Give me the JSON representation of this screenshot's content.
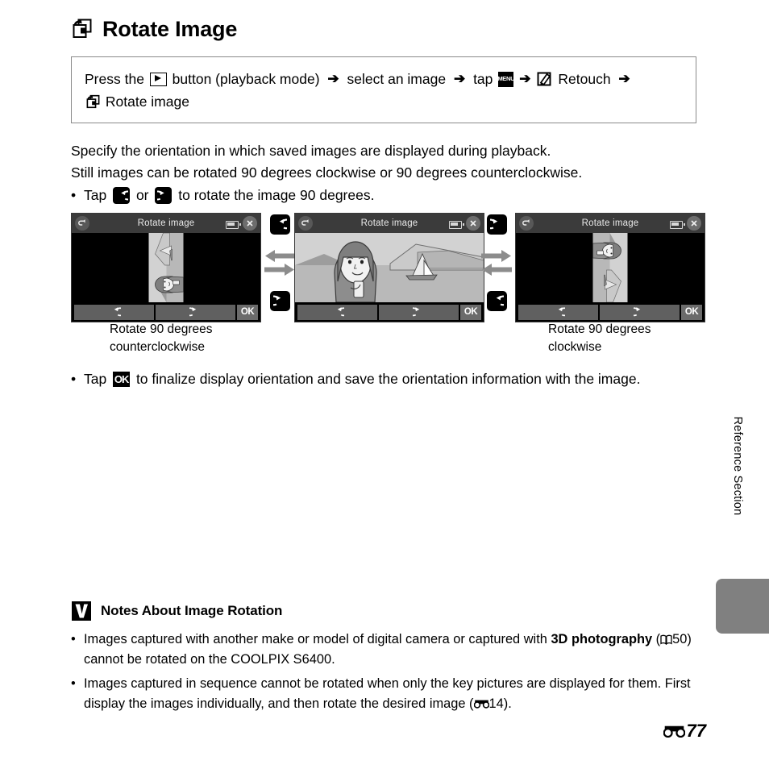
{
  "page": {
    "title": "Rotate Image",
    "title_icon": "rotate-image-icon",
    "footer_number": "77",
    "footer_icon": "reference-section-marker-icon",
    "side_label": "Reference Section"
  },
  "instruction": {
    "line1_part1": "Press the ",
    "icon_play": "playback-button-icon",
    "line1_part2": " button (playback mode) ",
    "arrow": "➔",
    "line1_part3": " select an image ",
    "line1_part4": " tap ",
    "icon_menu": "menu-button-icon",
    "icon_menu_label": "MENU",
    "icon_retouch": "retouch-pencil-icon",
    "line1_part5": " Retouch ",
    "icon_rotate": "rotate-image-icon",
    "line2": "Rotate image"
  },
  "body": {
    "para1": "Specify the orientation in which saved images are displayed during playback.",
    "para2": "Still images can be rotated 90 degrees clockwise or 90 degrees counterclockwise.",
    "bullet1_pre": "Tap ",
    "bullet1_mid": " or ",
    "bullet1_post": " to rotate the image 90 degrees.",
    "icon_ccw": "rotate-counterclockwise-icon",
    "icon_cw": "rotate-clockwise-icon",
    "bullet2_pre": "Tap ",
    "bullet2_ok": "OK",
    "bullet2_post": " to finalize display orientation and save the orientation information with the image."
  },
  "screens": [
    {
      "name": "rotated-counterclockwise-screen",
      "title": "Rotate image",
      "back_icon": "back-arrow-icon",
      "close_icon": "close-x-icon",
      "battery_icon": "battery-icon",
      "ok_label": "OK",
      "btn_ccw_icon": "rotate-counterclockwise-icon",
      "btn_cw_icon": "rotate-clockwise-icon",
      "orientation": "ccw"
    },
    {
      "name": "original-orientation-screen",
      "title": "Rotate image",
      "back_icon": "back-arrow-icon",
      "close_icon": "close-x-icon",
      "battery_icon": "battery-icon",
      "ok_label": "OK",
      "btn_ccw_icon": "rotate-counterclockwise-icon",
      "btn_cw_icon": "rotate-clockwise-icon",
      "orientation": "upright"
    },
    {
      "name": "rotated-clockwise-screen",
      "title": "Rotate image",
      "back_icon": "back-arrow-icon",
      "close_icon": "close-x-icon",
      "battery_icon": "battery-icon",
      "ok_label": "OK",
      "btn_ccw_icon": "rotate-counterclockwise-icon",
      "btn_cw_icon": "rotate-clockwise-icon",
      "orientation": "cw"
    }
  ],
  "captions": {
    "left_line1": "Rotate 90 degrees",
    "left_line2": "counterclockwise",
    "right_line1": "Rotate 90 degrees",
    "right_line2": "clockwise"
  },
  "notes": {
    "icon": "caution-checkmark-icon",
    "title": "Notes About Image Rotation",
    "items": [
      {
        "pre": "Images captured with another make or model of digital camera or captured with ",
        "bold": "3D photography",
        "mid": " (",
        "ref_icon": "manual-book-icon",
        "ref": "50",
        "post": ") cannot be rotated on the COOLPIX S6400."
      },
      {
        "pre": "Images captured in sequence cannot be rotated when only the key pictures are displayed for them. First display the images individually, and then rotate the desired image (",
        "ref_icon": "reference-section-marker-icon",
        "ref": "14",
        "post": ")."
      }
    ]
  },
  "colors": {
    "screen_titlebar": "#3b3b3b",
    "screen_body": "#000000",
    "toolbar_button": "#606060",
    "arrow_gray": "#8c8c8c",
    "side_tab": "#808080",
    "box_border": "#8a8a8a"
  }
}
